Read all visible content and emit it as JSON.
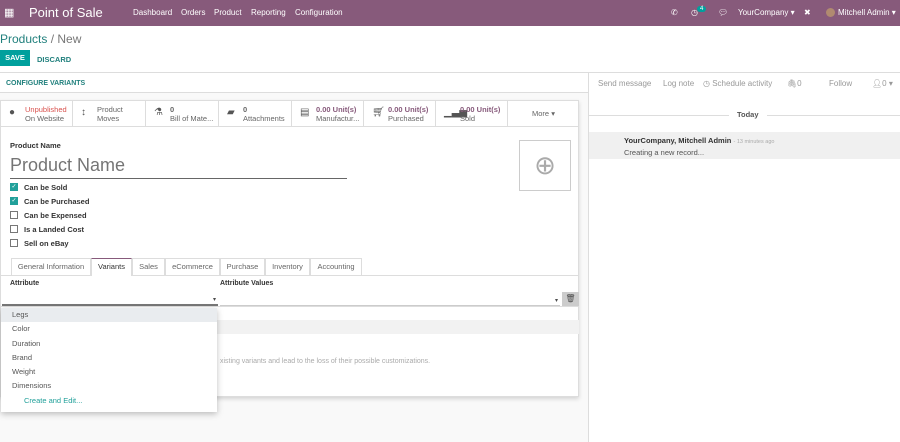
{
  "navbar": {
    "app_title": "Point of Sale",
    "menu": [
      "Dashboard",
      "Orders",
      "Product",
      "Reporting",
      "Configuration"
    ],
    "activity_count": "4",
    "company": "YourCompany",
    "user": "Mitchell Admin",
    "color": "#875a7b"
  },
  "breadcrumb": {
    "parent": "Products",
    "current": "New"
  },
  "actions": {
    "save": "SAVE",
    "discard": "DISCARD",
    "configure_variants": "CONFIGURE VARIANTS"
  },
  "smart_buttons": [
    {
      "line1": "Unpublished",
      "line2": "On Website",
      "icon": "globe-icon"
    },
    {
      "line1": "Product",
      "line2": "Moves",
      "icon": "arrows-v-icon"
    },
    {
      "line1": "0",
      "line2": "Bill of Mate...",
      "icon": "flask-icon"
    },
    {
      "line1": "0",
      "line2": "Attachments",
      "icon": "book-icon"
    },
    {
      "line1": "0.00 Unit(s)",
      "line2": "Manufactur...",
      "icon": "list-icon"
    },
    {
      "line1": "0.00 Unit(s)",
      "line2": "Purchased",
      "icon": "cart-icon"
    },
    {
      "line1": "0.00 Unit(s)",
      "line2": "Sold",
      "icon": "signal-icon"
    }
  ],
  "more": "More",
  "form": {
    "name_label": "Product Name",
    "name_placeholder": "Product Name",
    "checkboxes": [
      {
        "label": "Can be Sold",
        "checked": true
      },
      {
        "label": "Can be Purchased",
        "checked": true
      },
      {
        "label": "Can be Expensed",
        "checked": false
      },
      {
        "label": "Is a Landed Cost",
        "checked": false
      },
      {
        "label": "Sell on eBay",
        "checked": false
      }
    ],
    "tabs": [
      "General Information",
      "Variants",
      "Sales",
      "eCommerce",
      "Purchase",
      "Inventory",
      "Accounting"
    ],
    "active_tab": "Variants",
    "col_attribute": "Attribute",
    "col_values": "Attribute Values",
    "warning": "xisting variants and lead to the loss of their possible customizations."
  },
  "dropdown": {
    "options": [
      "Legs",
      "Color",
      "Duration",
      "Brand",
      "Weight",
      "Dimensions"
    ],
    "create": "Create and Edit..."
  },
  "chatter": {
    "send": "Send message",
    "log": "Log note",
    "schedule": "Schedule activity",
    "attachments": "0",
    "follow": "Follow",
    "followers": "0",
    "today": "Today",
    "author": "YourCompany, Mitchell Admin",
    "time": "- 13 minutes ago",
    "body": "Creating a new record..."
  }
}
